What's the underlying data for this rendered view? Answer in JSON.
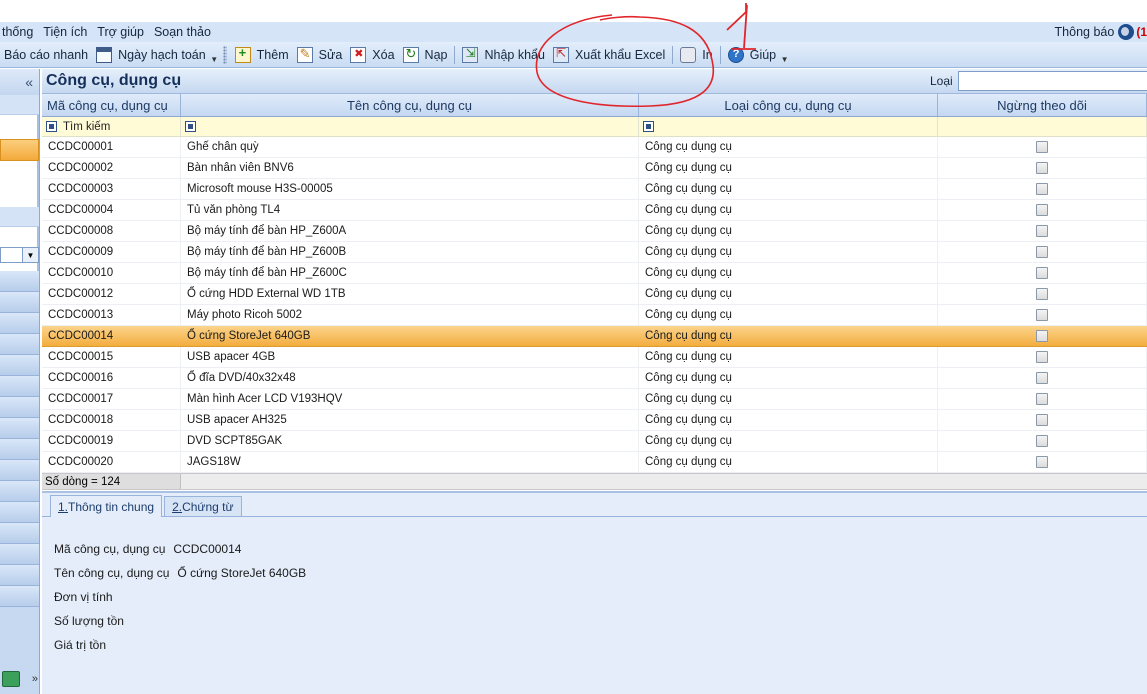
{
  "menubar": {
    "items": [
      "thống",
      "Tiện ích",
      "Trợ giúp",
      "Soạn thảo"
    ],
    "notify_label": "Thông báo",
    "notify_count": "(1"
  },
  "toolbar": {
    "items": [
      {
        "label": "Báo cáo nhanh",
        "icon": "report-icon"
      },
      {
        "label": "Ngày hạch toán",
        "icon": "calendar-icon"
      },
      {
        "label": "Thêm",
        "icon": "add-icon"
      },
      {
        "label": "Sửa",
        "icon": "edit-icon"
      },
      {
        "label": "Xóa",
        "icon": "delete-icon"
      },
      {
        "label": "Nạp",
        "icon": "reload-icon"
      },
      {
        "label": "Nhập khẩu",
        "icon": "import-icon"
      },
      {
        "label": "Xuất khẩu Excel",
        "icon": "export-excel-icon"
      },
      {
        "label": "In",
        "icon": "print-icon"
      },
      {
        "label": "Giúp",
        "icon": "help-icon"
      }
    ]
  },
  "leftpanel": {
    "collapse_glyph": "«",
    "more_glyph": "»"
  },
  "page": {
    "title": "Công cụ, dụng cụ",
    "type_filter_label": "Loại",
    "type_filter_value": ""
  },
  "grid": {
    "columns": [
      "Mã công cụ, dụng cụ",
      "Tên công cụ, dụng cụ",
      "Loại công cụ, dụng cụ",
      "Ngừng theo dõi"
    ],
    "filter_label": "Tìm kiếm",
    "rows": [
      {
        "code": "CCDC00001",
        "name": "Ghế chân quỳ",
        "type": "Công cụ dụng cụ",
        "inactive": false
      },
      {
        "code": "CCDC00002",
        "name": "Bàn nhân viên BNV6",
        "type": "Công cụ dụng cụ",
        "inactive": false
      },
      {
        "code": "CCDC00003",
        "name": "Microsoft mouse H3S-00005",
        "type": "Công cụ dụng cụ",
        "inactive": false
      },
      {
        "code": "CCDC00004",
        "name": "Tủ văn phòng TL4",
        "type": "Công cụ dụng cụ",
        "inactive": false
      },
      {
        "code": "CCDC00008",
        "name": "Bộ máy tính để bàn HP_Z600A",
        "type": "Công cụ dụng cụ",
        "inactive": false
      },
      {
        "code": "CCDC00009",
        "name": "Bộ máy tính để bàn HP_Z600B",
        "type": "Công cụ dụng cụ",
        "inactive": false
      },
      {
        "code": "CCDC00010",
        "name": "Bộ máy tính để bàn HP_Z600C",
        "type": "Công cụ dụng cụ",
        "inactive": false
      },
      {
        "code": "CCDC00012",
        "name": "Ổ cứng HDD External WD 1TB",
        "type": "Công cụ dụng cụ",
        "inactive": false
      },
      {
        "code": "CCDC00013",
        "name": "Máy photo Ricoh 5002",
        "type": "Công cụ dụng cụ",
        "inactive": false
      },
      {
        "code": "CCDC00014",
        "name": "Ổ cứng StoreJet 640GB",
        "type": "Công cụ dụng cụ",
        "inactive": false,
        "selected": true
      },
      {
        "code": "CCDC00015",
        "name": "USB apacer 4GB",
        "type": "Công cụ dụng cụ",
        "inactive": false
      },
      {
        "code": "CCDC00016",
        "name": "Ổ đĩa DVD/40x32x48",
        "type": "Công cụ dụng cụ",
        "inactive": false
      },
      {
        "code": "CCDC00017",
        "name": "Màn hình Acer LCD V193HQV",
        "type": "Công cụ dụng cụ",
        "inactive": false
      },
      {
        "code": "CCDC00018",
        "name": "USB apacer AH325",
        "type": "Công cụ dụng cụ",
        "inactive": false
      },
      {
        "code": "CCDC00019",
        "name": "DVD SCPT85GAK",
        "type": "Công cụ dụng cụ",
        "inactive": false
      },
      {
        "code": "CCDC00020",
        "name": "JAGS18W",
        "type": "Công cụ dụng cụ",
        "inactive": false
      }
    ],
    "row_count_label": "Số dòng = 124"
  },
  "detail": {
    "tabs": [
      {
        "key": "1.",
        "label": " Thông tin chung"
      },
      {
        "key": "2.",
        "label": " Chứng từ"
      }
    ],
    "fields": [
      {
        "label": "Mã công cụ, dụng cụ",
        "value": "CCDC00014"
      },
      {
        "label": "Tên công cụ, dụng cụ",
        "value": "Ổ cứng StoreJet 640GB"
      },
      {
        "label": "Đơn vị tính",
        "value": ""
      },
      {
        "label": "Số lượng tồn",
        "value": ""
      },
      {
        "label": "Giá trị tồn",
        "value": ""
      }
    ]
  },
  "annotation": {
    "marker_label": "1",
    "color": "#e0262b"
  },
  "colors": {
    "selected_row": "#f3ad3f",
    "header_blue": "#c5d8f1",
    "annotation_red": "#e0262b"
  }
}
